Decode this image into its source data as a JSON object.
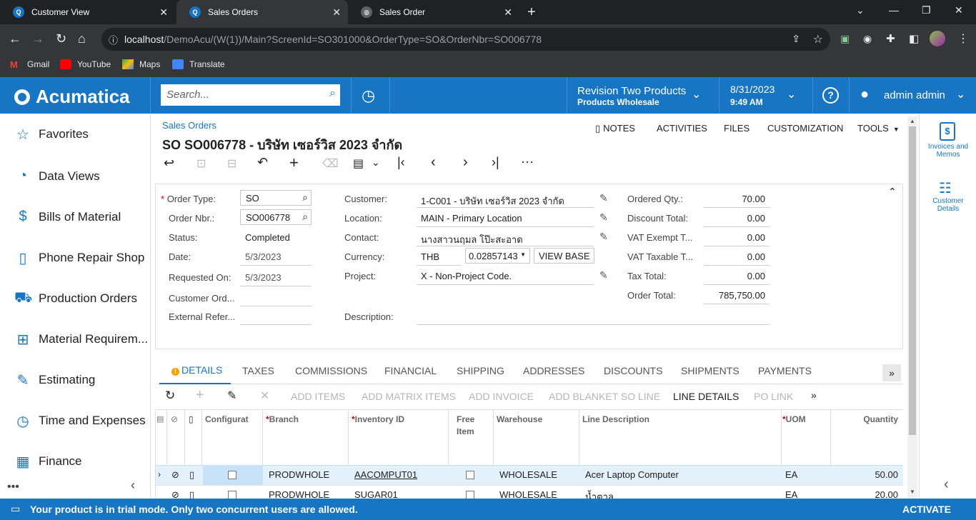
{
  "browser": {
    "tabs": [
      {
        "title": "Customer View"
      },
      {
        "title": "Sales Orders"
      },
      {
        "title": "Sales Order"
      }
    ],
    "url_host": "localhost",
    "url_path": "/DemoAcu/(W(1))/Main?ScreenId=SO301000&OrderType=SO&OrderNbr=SO006778",
    "bookmarks": [
      "Gmail",
      "YouTube",
      "Maps",
      "Translate"
    ]
  },
  "header": {
    "logo": "Acumatica",
    "search_placeholder": "Search...",
    "company": "Revision Two Products",
    "branch": "Products Wholesale",
    "date": "8/31/2023",
    "time": "9:49 AM",
    "user": "admin admin"
  },
  "sidebar": {
    "items": [
      {
        "label": "Favorites",
        "icon": "star-icon"
      },
      {
        "label": "Data Views",
        "icon": "pie-chart-icon"
      },
      {
        "label": "Bills of Material",
        "icon": "document-dollar-icon"
      },
      {
        "label": "Phone Repair Shop",
        "icon": "phone-icon"
      },
      {
        "label": "Production Orders",
        "icon": "truck-icon"
      },
      {
        "label": "Material Requirem...",
        "icon": "cart-plus-icon"
      },
      {
        "label": "Estimating",
        "icon": "pencil-icon"
      },
      {
        "label": "Time and Expenses",
        "icon": "stopwatch-icon"
      },
      {
        "label": "Finance",
        "icon": "calculator-icon"
      }
    ]
  },
  "page": {
    "breadcrumb": "Sales Orders",
    "title": "SO SO006778 - บริษัท เซอร์วิส 2023 จำกัด",
    "top_actions": [
      "NOTES",
      "ACTIVITIES",
      "FILES",
      "CUSTOMIZATION",
      "TOOLS"
    ]
  },
  "form": {
    "order_type_label": "Order Type:",
    "order_type": "SO",
    "order_nbr_label": "Order Nbr.:",
    "order_nbr": "SO006778",
    "status_label": "Status:",
    "status": "Completed",
    "date_label": "Date:",
    "date": "5/3/2023",
    "requested_on_label": "Requested On:",
    "requested_on": "5/3/2023",
    "customer_ord_label": "Customer Ord...",
    "external_ref_label": "External Refer...",
    "customer_label": "Customer:",
    "customer": "1-C001 - บริษัท เซอร์วิส 2023 จำกัด",
    "location_label": "Location:",
    "location": "MAIN - Primary Location",
    "contact_label": "Contact:",
    "contact": "นางสาวนฤมล โป๊ะสะอาด",
    "currency_label": "Currency:",
    "currency": "THB",
    "rate": "0.02857143",
    "view_base": "VIEW BASE",
    "project_label": "Project:",
    "project": "X - Non-Project Code.",
    "description_label": "Description:",
    "ordered_qty_label": "Ordered Qty.:",
    "ordered_qty": "70.00",
    "discount_total_label": "Discount Total:",
    "discount_total": "0.00",
    "vat_exempt_label": "VAT Exempt T...",
    "vat_exempt": "0.00",
    "vat_taxable_label": "VAT Taxable T...",
    "vat_taxable": "0.00",
    "tax_total_label": "Tax Total:",
    "tax_total": "0.00",
    "order_total_label": "Order Total:",
    "order_total": "785,750.00"
  },
  "tabs": [
    "DETAILS",
    "TAXES",
    "COMMISSIONS",
    "FINANCIAL",
    "SHIPPING",
    "ADDRESSES",
    "DISCOUNTS",
    "SHIPMENTS",
    "PAYMENTS"
  ],
  "grid_toolbar": [
    "ADD ITEMS",
    "ADD MATRIX ITEMS",
    "ADD INVOICE",
    "ADD BLANKET SO LINE",
    "LINE DETAILS",
    "PO LINK"
  ],
  "grid": {
    "headers": {
      "configurable": "Configurat",
      "branch": "Branch",
      "inventory_id": "Inventory ID",
      "free_item_1": "Free",
      "free_item_2": "Item",
      "warehouse": "Warehouse",
      "line_description": "Line Description",
      "uom": "UOM",
      "quantity": "Quantity"
    },
    "rows": [
      {
        "branch": "PRODWHOLE",
        "inventory_id": "AACOMPUT01",
        "warehouse": "WHOLESALE",
        "description": "Acer Laptop Computer",
        "uom": "EA",
        "quantity": "50.00"
      },
      {
        "branch": "PRODWHOLE",
        "inventory_id": "SUGAR01",
        "warehouse": "WHOLESALE",
        "description": "น้ำตาล",
        "uom": "EA",
        "quantity": "20.00"
      }
    ]
  },
  "right_panel": [
    {
      "label_1": "Invoices and",
      "label_2": "Memos"
    },
    {
      "label_1": "Customer",
      "label_2": "Details"
    }
  ],
  "footer": {
    "message": "Your product is in trial mode. Only two concurrent users are allowed.",
    "action": "ACTIVATE"
  },
  "colors": {
    "brand": "#1775c3",
    "chrome_dark": "#202124",
    "chrome_mid": "#35363a"
  }
}
